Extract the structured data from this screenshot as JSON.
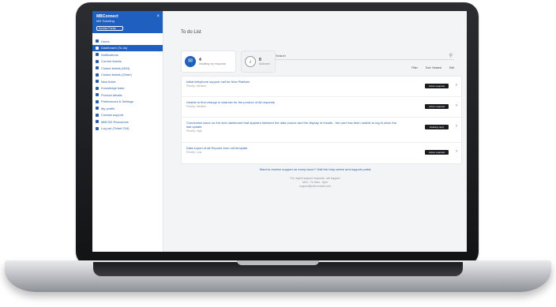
{
  "app": {
    "brand_title": "MBConnect",
    "brand_subtitle": "MB Ticketing",
    "brand_button": "Access Portal",
    "close_glyph": "×"
  },
  "sidebar": {
    "items": [
      {
        "label": "Home",
        "active": false
      },
      {
        "label": "Dashboard (To do)",
        "active": true
      },
      {
        "label": "Notifications",
        "active": false
      },
      {
        "label": "Current tickets",
        "active": false
      },
      {
        "label": "Closed tickets (DMI)",
        "active": false
      },
      {
        "label": "Closed tickets (Other)",
        "active": false
      },
      {
        "label": "New ticket",
        "active": false
      },
      {
        "label": "Knowledge base",
        "active": false
      },
      {
        "label": "Product details",
        "active": false
      },
      {
        "label": "Preferences & Settings",
        "active": false
      },
      {
        "label": "My profile",
        "active": false
      },
      {
        "label": "Contact support",
        "active": false
      },
      {
        "label": "MBCSD Resources",
        "active": false
      },
      {
        "label": "Log out (Ticket 234)",
        "active": false
      }
    ]
  },
  "main": {
    "title": "To do List",
    "stats": [
      {
        "value": "4",
        "label": "Awaiting my response",
        "icon": "inbox-icon"
      },
      {
        "value": "0",
        "label": "Actioned",
        "icon": "bell-icon"
      }
    ],
    "search": {
      "placeholder": "Search",
      "icon": "search-icon"
    },
    "toolbar": [
      "Filter",
      "Sort: Newest",
      "Edit"
    ],
    "rows": [
      {
        "title": "Initial telephone support call for New Platform",
        "meta": "Priority: Medium",
        "badge": "Action required"
      },
      {
        "title": "Unable to find change in data tab for the product of All requests",
        "meta": "Priority: Medium",
        "badge": "Action required"
      },
      {
        "title": "Connection issue on the new dashboard that appears between the data source and the display of results - the user has been unable to log in since the last update",
        "meta": "Priority: High",
        "badge": "Awaiting reply"
      },
      {
        "title": "Data export of all Reports from old template",
        "meta": "Priority: Low",
        "badge": "Action required"
      }
    ],
    "footer_link": "Want to receive support on every issue? Visit the help centre and support portal",
    "footer_lines": [
      "For urgent support requests, call support",
      "Mon - Fri 8am - 6pm",
      "support@mbconnect.com"
    ]
  },
  "colors": {
    "accent": "#1f5fbf",
    "link": "#2a5ea8",
    "badge": "#1b1c1e"
  }
}
